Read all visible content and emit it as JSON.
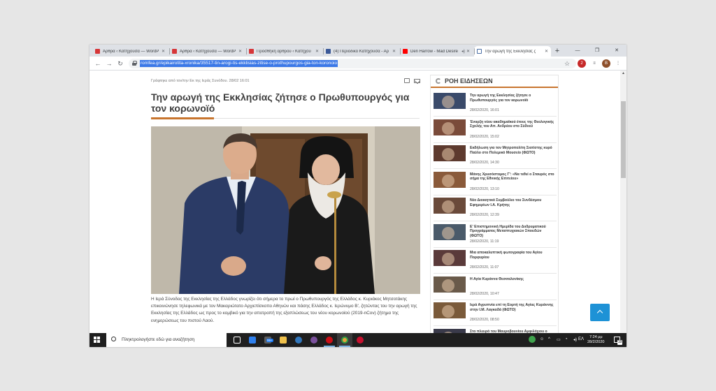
{
  "browser": {
    "tabs": [
      {
        "label": "Άρθρα ‹ Κατηχούσα — WordP",
        "favicon": "wordpress-icon"
      },
      {
        "label": "Άρθρα ‹ Κατηχούσα — WordP",
        "favicon": "wordpress-icon"
      },
      {
        "label": "Προσθήκη άρθρου ‹ Κατηχού",
        "favicon": "wordpress-icon"
      },
      {
        "label": "(4) Περιοδικό Κατηχούσα - Αρ",
        "favicon": "facebook-icon"
      },
      {
        "label": "Den Harrow - Mad Desire",
        "favicon": "youtube-icon"
      },
      {
        "label": "Την αρωγή της Εκκλησίας ζ",
        "favicon": "romfea-icon",
        "active": true
      }
    ],
    "new_tab": "+",
    "window_controls": {
      "minimize": "—",
      "maximize": "❐",
      "close": "✕"
    },
    "url": "romfea.gr/epikairotita-xronika/35517-tin-arogi-tis-ekklisias-zitise-o-prothupourgos-gia-ton-koronoio",
    "extensions": {
      "badge_count": "2",
      "profile": "B"
    }
  },
  "article": {
    "meta": "Γράφτηκε από τον/την Εκ της Ιεράς Συνόδου. 28/02 16:01",
    "title": "Την αρωγή της Εκκλησίας ζήτησε ο Πρωθυπουργός για τον κορωνοϊό",
    "body": "Η Ιερά Σύνοδος της Εκκλησίας της Ελλάδος γνωρίζει ότι σήμερα το πρωί ο Πρωθυπουργός της Ελλάδος κ. Κυριάκος Μητσοτάκης επικοινώνησε τηλεφωνικά με τον Μακαριώτατο Αρχιεπίσκοπο Αθηνών και πάσης Ελλάδος κ. Ιερώνυμο Β', ζητώντας του την αρωγή της Εκκλησίας της Ελλάδος ως προς το κομβικό για την αποτροπή της εξαπλώσεως του νέου κορωνοϊού (2019-nCov) ζήτημα της ενημερώσεως του πιστού Λαού."
  },
  "sidebar": {
    "title": "ΡΟΗ ΕΙΔΗΣΕΩΝ",
    "items": [
      {
        "title": "Την αρωγή της Εκκλησίας ζήτησε ο Πρωθυπουργός για τον κορωνοϊό",
        "date": "28/02/2020, 16:01"
      },
      {
        "title": "Έναρξη νέου ακαδημαϊκού έτους της Θεολογικής Σχολής του Απ. Ανδρέου στο Σύδνεϋ",
        "date": "28/02/2020, 15:02"
      },
      {
        "title": "Εκδήλωση για τον Μητροπολίτη Σιατίστης κυρό Παύλο στο Πολεμικό Μουσείο (ΦΩΤΟ)",
        "date": "28/02/2020, 14:30"
      },
      {
        "title": "Μάνης Χρυσόστομος Γ': «Να τεθεί ο Σταυρός στο σήμα της Εθνικής Επιτείου»",
        "date": "28/02/2020, 13:10"
      },
      {
        "title": "Νέο Διοικητικό Συμβούλιο του Συνδέσμου Εφημερίων Ι.Α. Κρήτης",
        "date": "28/02/2020, 12:39"
      },
      {
        "title": "Ε' Επιστημονική Ημερίδα του Διιδρυματικού Προγράμματος Μεταπτυχιακών Σπουδών (ΦΩΤΟ)",
        "date": "28/02/2020, 11:19"
      },
      {
        "title": "Μια αποκαλυπτική φωτογραφία του Αγίου Πορφυρίου",
        "date": "28/02/2020, 11:07"
      },
      {
        "title": "Η Αγία Κυράννα Θεσσαλονίκης",
        "date": "28/02/2020, 10:47"
      },
      {
        "title": "Ιερά Αγρυπνία επί τη Εορτή της Αγίας Κυράννης στην Ι.Μ. Λαγκαδά (ΦΩΤΟ)",
        "date": "28/02/2020, 08:50"
      },
      {
        "title": "Στο πλευρό του Μαυροβουνίου Αμφιλόχιου ο Μητροπολίτης Ουγγροβλαχίας (ΦΩΤΟ)",
        "date": ""
      }
    ]
  },
  "taskbar": {
    "search_placeholder": "Πληκτρολογήστε εδώ για αναζήτηση",
    "badge": "99+",
    "language": "ΕΛ",
    "time": "7:24 μμ",
    "date": "28/2/2020",
    "notification_count": "19"
  },
  "colors": {
    "accent": "#c8752e",
    "url_selection": "#3b78e7",
    "back_to_top": "#1e92d6"
  }
}
